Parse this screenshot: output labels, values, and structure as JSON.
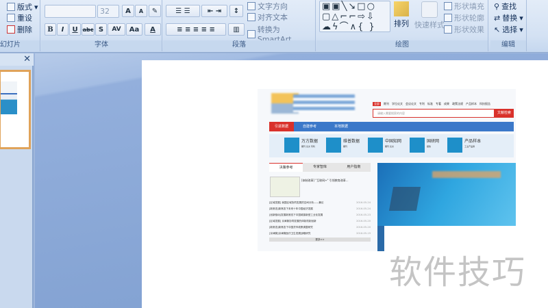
{
  "ribbon": {
    "slides": {
      "label": "幻灯片",
      "layout": "版式",
      "reset": "重设",
      "delete": "删除"
    },
    "font": {
      "label": "字体",
      "font_name": "",
      "font_size": "32",
      "bold": "B",
      "italic": "I",
      "underline": "U",
      "strike": "abc",
      "shadow": "S",
      "spacing": "AV",
      "case": "Aa",
      "color": "A",
      "grow": "A",
      "shrink": "A"
    },
    "paragraph": {
      "label": "段落",
      "text_direction": "文字方向",
      "align_text": "对齐文本",
      "smartart": "转换为 SmartArt"
    },
    "drawing": {
      "label": "绘图",
      "arrange": "排列",
      "quick_styles": "快速样式",
      "shape_fill": "形状填充",
      "shape_outline": "形状轮廓",
      "shape_effects": "形状效果"
    },
    "editing": {
      "label": "编辑",
      "find": "查找",
      "replace": "替换",
      "select": "选择"
    }
  },
  "panel": {
    "close": "✕"
  },
  "picture": {
    "search_tabs": [
      "全部",
      "期刊",
      "学位论文",
      "会议论文",
      "专利",
      "标准",
      "专著",
      "成果",
      "政策法规",
      "产品样本",
      "科技报告"
    ],
    "search_placeholder": "请输入需要搜索的内容",
    "search_button": "文献检索",
    "nav": [
      "引进数据",
      "自建参考",
      "本地数据"
    ],
    "databases": [
      {
        "name": "万方数据",
        "desc": "期刊 论文 专利"
      },
      {
        "name": "维普数据",
        "desc": "期刊"
      },
      {
        "name": "中国知网",
        "desc": "期刊 论文"
      },
      {
        "name": "国研网",
        "desc": "报告"
      },
      {
        "name": "产品样本",
        "desc": "工业产品库"
      }
    ],
    "tabs": [
      "决策参考",
      "专家智库",
      "用户指南"
    ],
    "feature_title": "[体制改革] \"互联网+\" 引领教育改革...",
    "news": [
      {
        "t": "[区域发展] 我国区域协同发展的空间分析——兼论",
        "d": "2016-05-24"
      },
      {
        "t": "[新常态]新常态下未来十年中国经济发展",
        "d": "2016-05-24"
      },
      {
        "t": "[创新驱动]发展新常态下中国城镇新型工业化发展",
        "d": "2016-05-23"
      },
      {
        "t": "[区域发展] 京津冀协同发展的体制机制创新",
        "d": "2016-05-20"
      },
      {
        "t": "[新常态]新常态下中国货币政策调整研究",
        "d": "2016-05-20"
      },
      {
        "t": "[京津冀]京津冀医疗卫生发展战略研究",
        "d": "2016-05-19"
      }
    ],
    "more": "更多>>"
  },
  "watermark": "软件技巧"
}
